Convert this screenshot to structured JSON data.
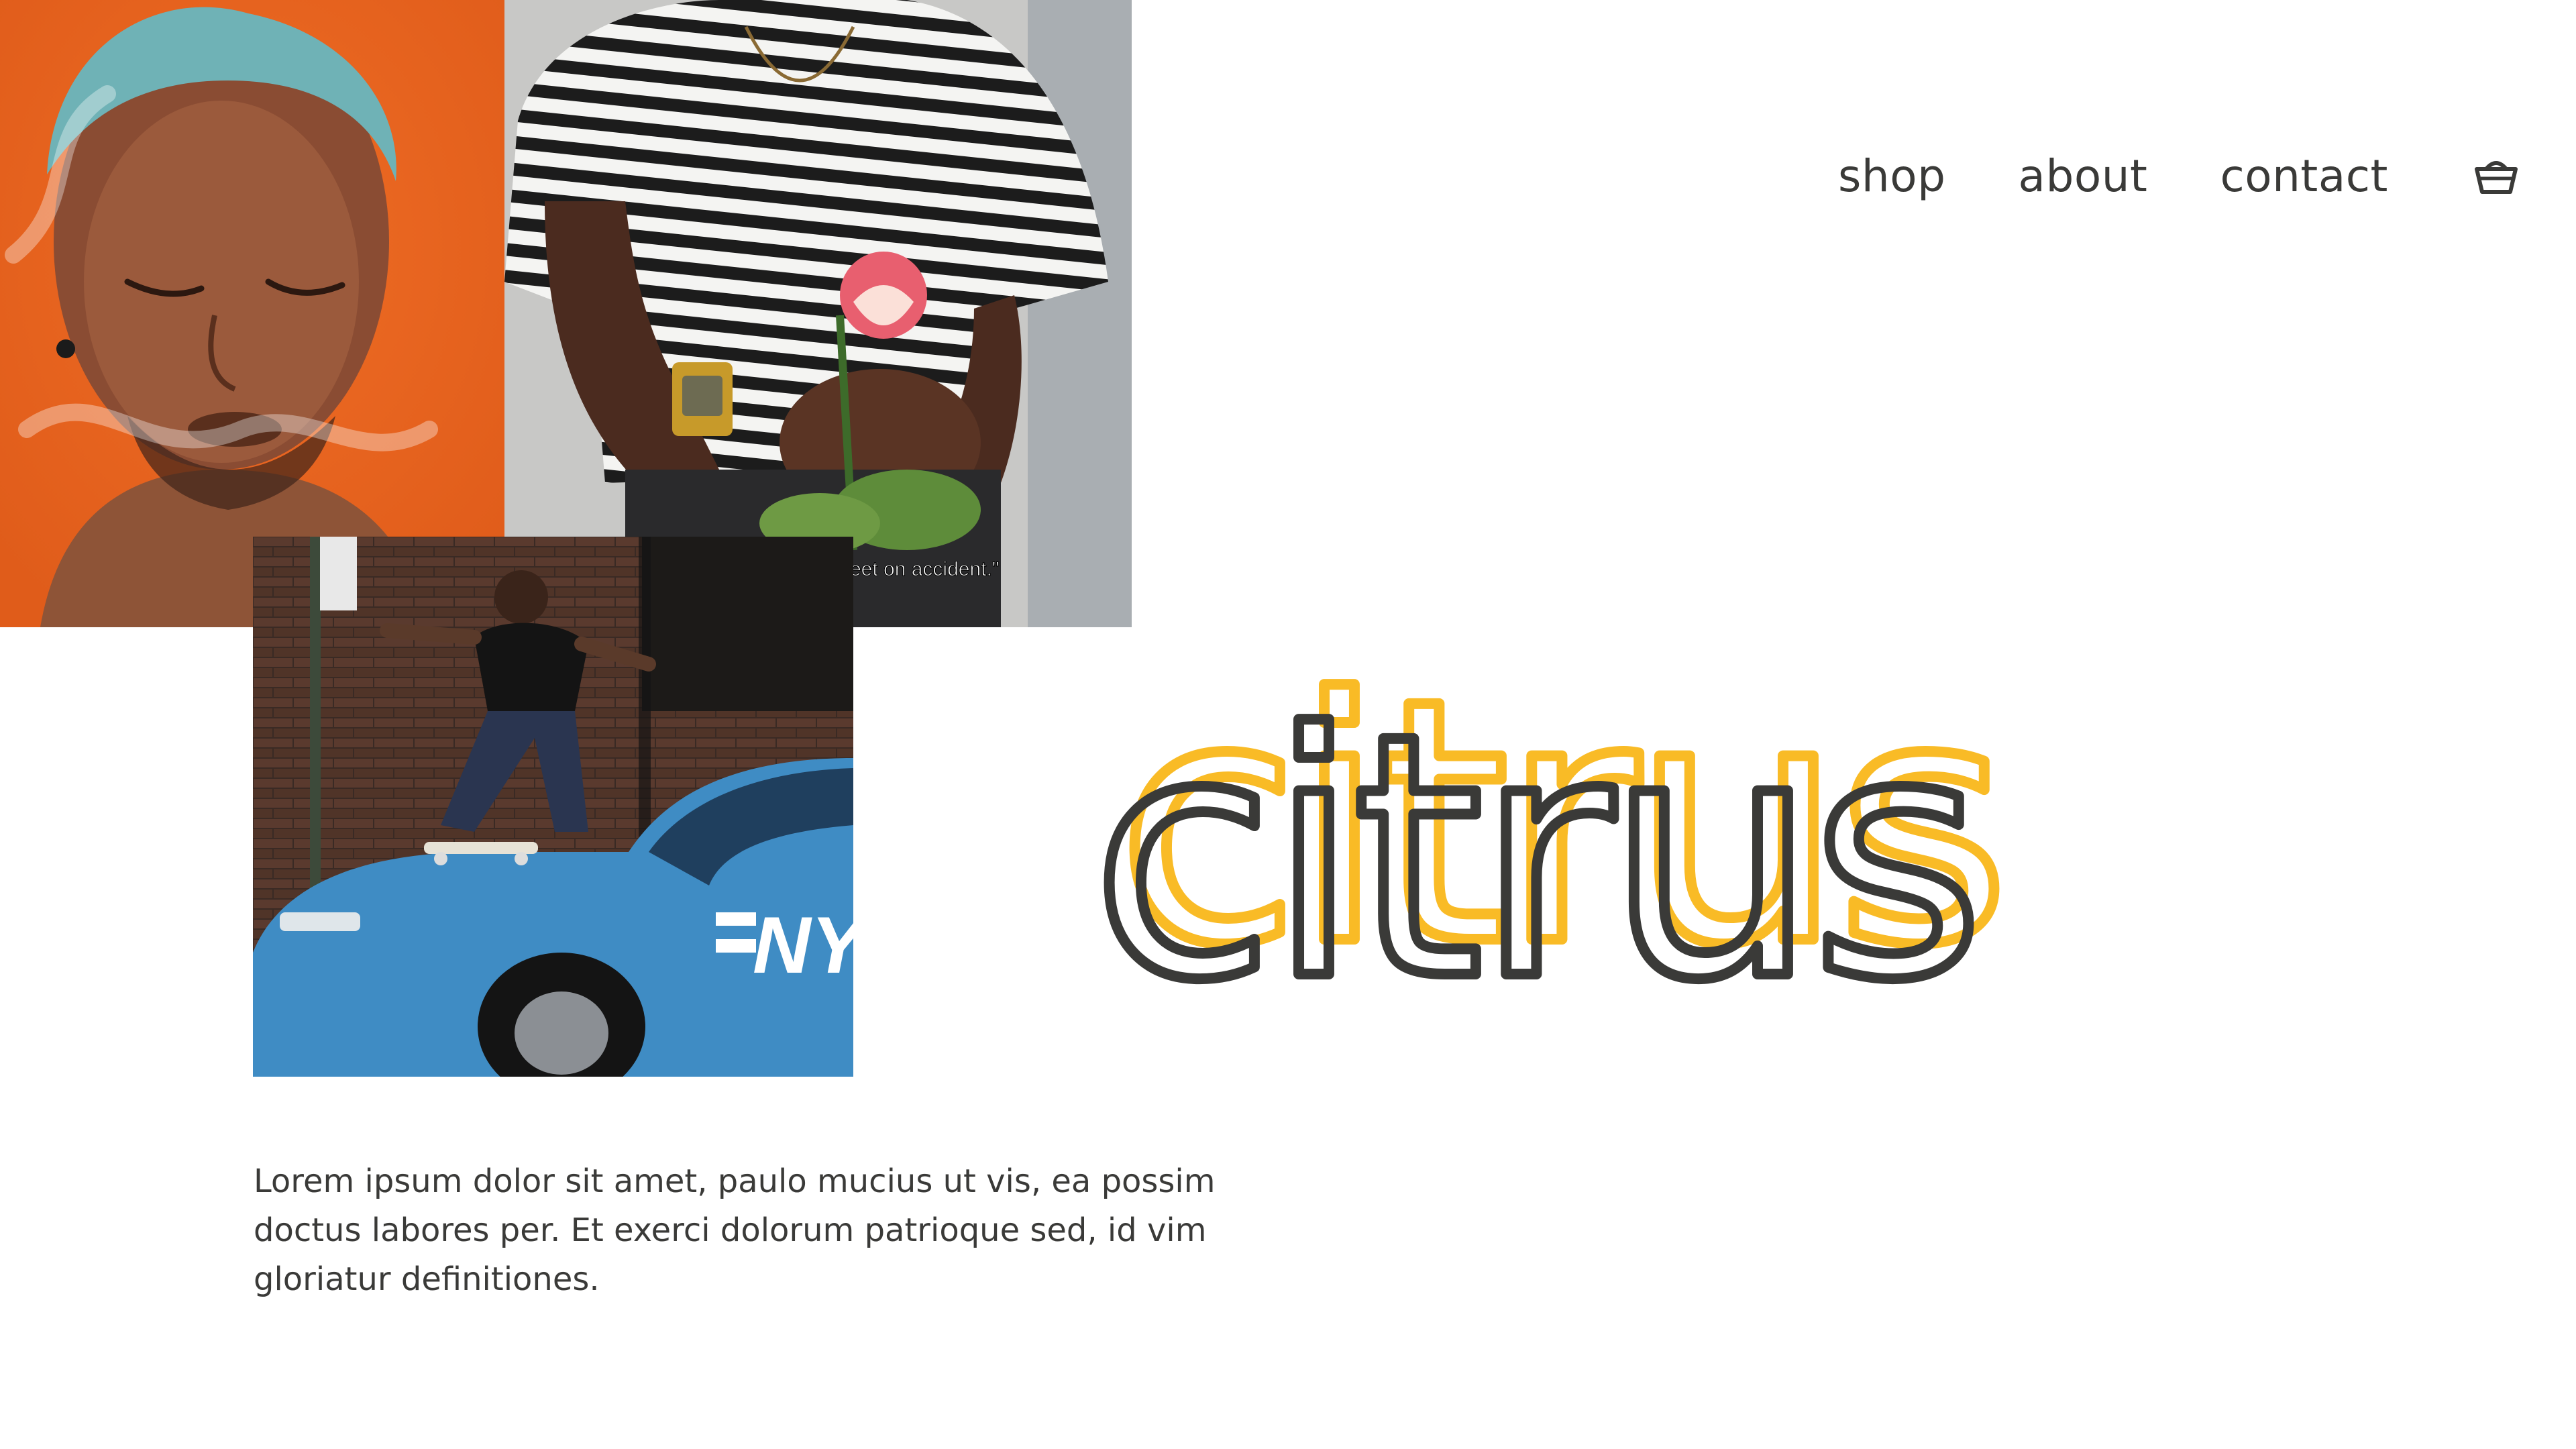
{
  "nav": {
    "items": [
      {
        "label": "shop"
      },
      {
        "label": "about"
      },
      {
        "label": "contact"
      }
    ],
    "cart_icon": "basket-icon"
  },
  "hero": {
    "wordmark": "citrus",
    "photo_caption": "eet on accident.\"",
    "taxi_text": "NY",
    "body": "Lorem ipsum dolor sit amet, paulo mucius ut vis, ea possim doctus labores per. Et exerci dolorum patrioque sed, id vim gloriatur definitiones."
  },
  "colors": {
    "text": "#3a3a38",
    "accent_yellow": "#f9bb26",
    "portrait_bg": "#e9621d",
    "taxi_blue": "#3f8cc4"
  }
}
